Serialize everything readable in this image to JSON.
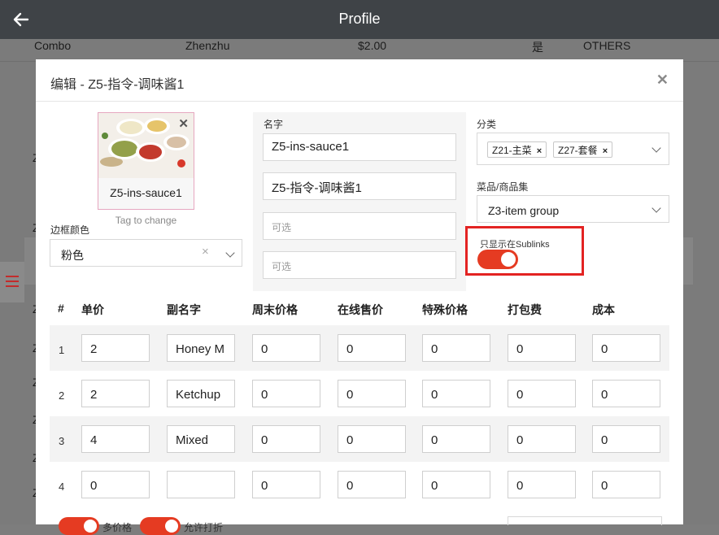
{
  "topbar": {
    "title": "Profile"
  },
  "background": {
    "first_row": [
      "Combo",
      "Zhenzhu",
      "$2.00",
      "是",
      "OTHERS"
    ],
    "stubs": [
      "Z",
      "Z",
      "Z",
      "Z",
      "Z",
      "Z",
      "Z",
      "Z"
    ]
  },
  "modal": {
    "title": "编辑 - Z5-指令-调味酱1",
    "image": {
      "label": "Z5-ins-sauce1",
      "hint": "Tag to change"
    },
    "border_color": {
      "label": "边框颜色",
      "value": "粉色"
    },
    "name": {
      "label": "名字",
      "value_en": "Z5-ins-sauce1",
      "value_zh": "Z5-指令-调味酱1",
      "optional1": "可选",
      "optional2": "可选"
    },
    "category": {
      "label": "分类",
      "chips": [
        "Z21-主菜",
        "Z27-套餐"
      ]
    },
    "item_group": {
      "label": "菜品/商品集",
      "value": "Z3-item group"
    },
    "sublinks": {
      "label": "只显示在Sublinks",
      "on": true
    },
    "table": {
      "headers": [
        "#",
        "单价",
        "副名字",
        "周末价格",
        "在线售价",
        "特殊价格",
        "打包费",
        "成本"
      ],
      "rows": [
        {
          "num": "1",
          "cells": [
            "2",
            "Honey M",
            "0",
            "0",
            "0",
            "0",
            "0"
          ]
        },
        {
          "num": "2",
          "cells": [
            "2",
            "Ketchup",
            "0",
            "0",
            "0",
            "0",
            "0"
          ]
        },
        {
          "num": "3",
          "cells": [
            "4",
            "Mixed",
            "0",
            "0",
            "0",
            "0",
            "0"
          ]
        },
        {
          "num": "4",
          "cells": [
            "0",
            "",
            "0",
            "0",
            "0",
            "0",
            "0"
          ]
        }
      ]
    },
    "bottom": {
      "toggle1_label": "多价格",
      "toggle2_label": "允许打折"
    }
  },
  "colors": {
    "accent": "#e53b22",
    "highlight_border": "#e32322",
    "topbar": "#3f4347"
  },
  "icons": {
    "back": "back-arrow-icon",
    "close": "close-icon",
    "menu": "hamburger-menu-icon"
  }
}
